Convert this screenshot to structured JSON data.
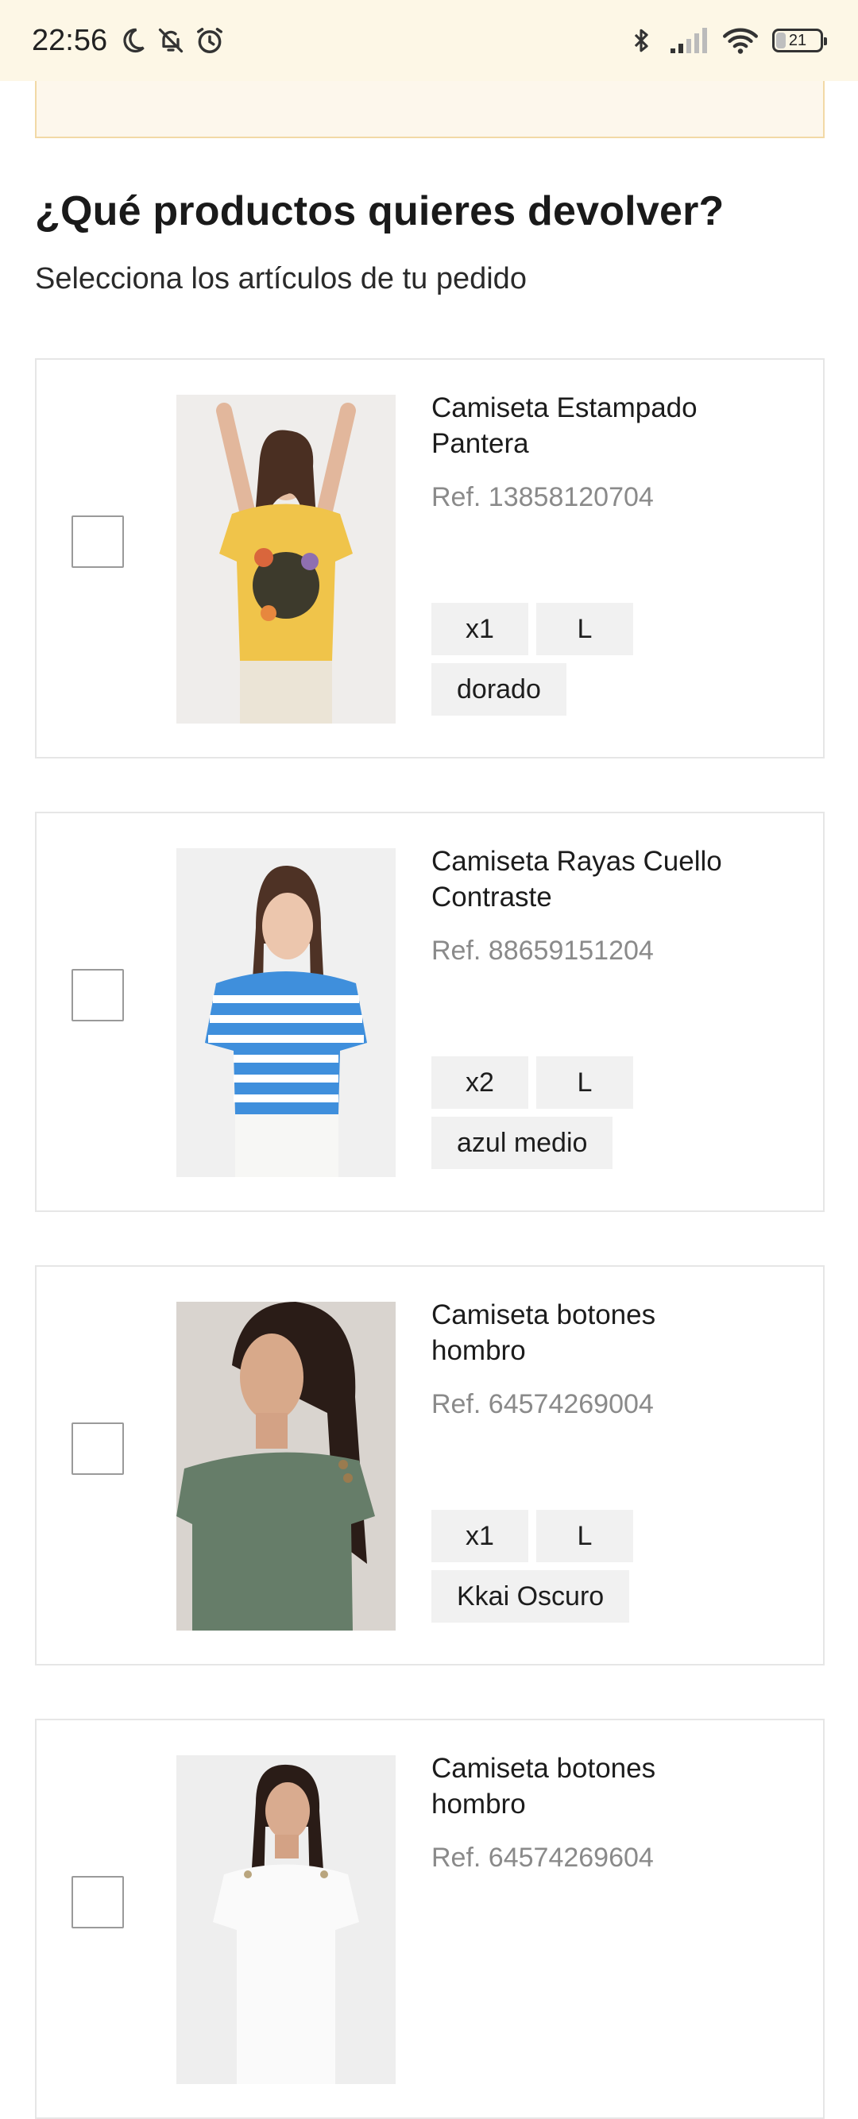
{
  "status_bar": {
    "time": "22:56",
    "battery": "21",
    "left_icons": [
      "moon-icon",
      "bell-off-icon",
      "alarm-icon"
    ],
    "right_icons": [
      "bluetooth-icon",
      "signal-icon",
      "wifi-icon",
      "battery-icon"
    ]
  },
  "page": {
    "title": "¿Qué productos quieres devolver?",
    "subtitle": "Selecciona los artículos de tu pedido"
  },
  "products": [
    {
      "name": "Camiseta Estampado Pantera",
      "ref": "Ref. 13858120704",
      "qty": "x1",
      "size": "L",
      "color": "dorado",
      "checked": false,
      "shirt_color": "#f0c44a"
    },
    {
      "name": "Camiseta Rayas Cuello Contraste",
      "ref": "Ref. 88659151204",
      "qty": "x2",
      "size": "L",
      "color": "azul medio",
      "checked": false,
      "shirt_color": "#3f8fdc"
    },
    {
      "name": "Camiseta botones hombro",
      "ref": "Ref. 64574269004",
      "qty": "x1",
      "size": "L",
      "color": "Kkai Oscuro",
      "checked": false,
      "shirt_color": "#667d69"
    },
    {
      "name": "Camiseta botones hombro",
      "ref": "Ref. 64574269604",
      "qty": "",
      "size": "",
      "color": "",
      "checked": false,
      "shirt_color": "#f4f4f2"
    }
  ]
}
